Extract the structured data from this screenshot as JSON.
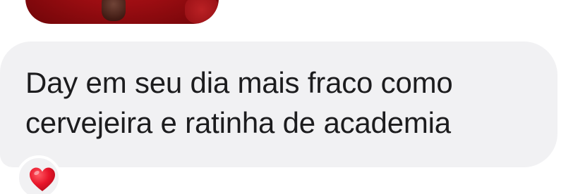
{
  "message": {
    "text": "Day em seu dia mais fraco como\ncervejeira e ratinha de academia",
    "bubble_color": "#f1f1f3",
    "text_color": "#1c1c1e"
  },
  "reaction": {
    "icon": "heart-icon",
    "color": "#e8152a"
  },
  "attachment": {
    "icon": "image-thumbnail",
    "dominant_color": "#a3101a"
  }
}
